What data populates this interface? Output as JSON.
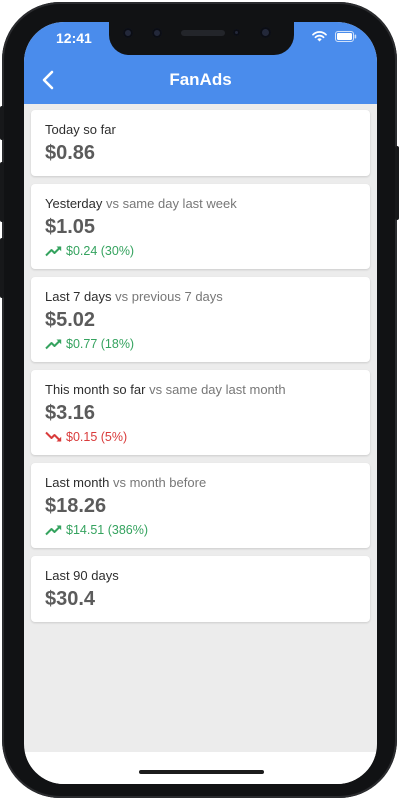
{
  "status_bar": {
    "time": "12:41",
    "icons": [
      "wifi-icon",
      "battery-icon"
    ]
  },
  "app_bar": {
    "title": "FanAds",
    "back_icon": "chevron-left-icon"
  },
  "colors": {
    "app_bar": "#4a8cec",
    "positive": "#35a35f",
    "negative": "#d93b3b",
    "background": "#ececec"
  },
  "cards": [
    {
      "label": "Today so far",
      "comparison": "",
      "amount": "$0.86",
      "change": null
    },
    {
      "label": "Yesterday",
      "comparison": "vs same day last week",
      "amount": "$1.05",
      "change": {
        "direction": "up",
        "text": "$0.24 (30%)"
      }
    },
    {
      "label": "Last 7 days",
      "comparison": "vs previous 7 days",
      "amount": "$5.02",
      "change": {
        "direction": "up",
        "text": "$0.77 (18%)"
      }
    },
    {
      "label": "This month so far",
      "comparison": "vs same day last month",
      "amount": "$3.16",
      "change": {
        "direction": "down",
        "text": "$0.15 (5%)"
      }
    },
    {
      "label": "Last month",
      "comparison": "vs month before",
      "amount": "$18.26",
      "change": {
        "direction": "up",
        "text": "$14.51 (386%)"
      }
    },
    {
      "label": "Last 90 days",
      "comparison": "",
      "amount": "$30.4",
      "change": null
    }
  ]
}
